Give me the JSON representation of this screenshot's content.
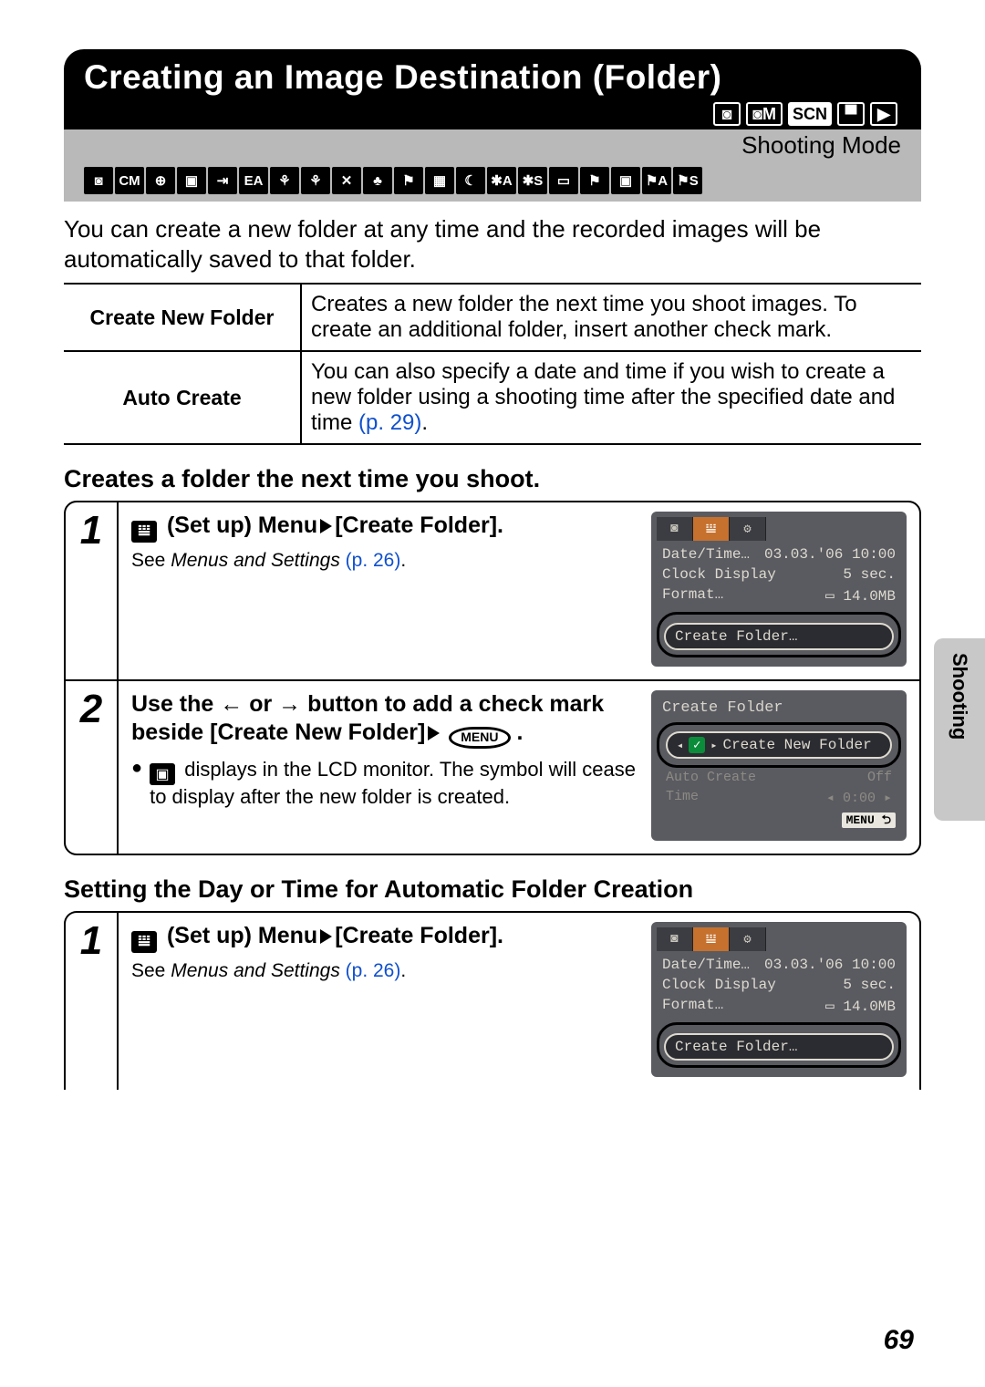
{
  "header": {
    "title": "Creating an Image Destination (Folder)",
    "mode_badges": [
      "◙",
      "◙M",
      "SCN",
      "▀",
      "▶"
    ],
    "shooting_mode_label": "Shooting Mode",
    "strip_icons": [
      "◙",
      "CM",
      "⊕",
      "▣",
      "⇥",
      "EA",
      "⚘",
      "⚘",
      "✕",
      "♣",
      "⚑",
      "▦",
      "☾",
      "✱A",
      "✱S",
      "▭",
      "⚑",
      "▣",
      "⚑A",
      "⚑S"
    ]
  },
  "intro": "You can create a new folder at any time and the recorded images will be automatically saved to that folder.",
  "table": {
    "row1_label": "Create New Folder",
    "row1_desc": "Creates a new folder the next time you shoot images. To create an additional folder, insert another check mark.",
    "row2_label": "Auto Create",
    "row2_desc_pre": "You can also specify a date and time if you wish to create a new folder using a shooting time after the specified date and time ",
    "row2_pref": "(p. 29)",
    "row2_desc_post": "."
  },
  "section1": {
    "heading": "Creates a folder the next time you shoot.",
    "step1": {
      "num": "1",
      "title_pre": " (Set up) Menu",
      "title_mid": "[Create Folder].",
      "note_pre": "See ",
      "note_ital": "Menus and Settings",
      "note_pref": " (p. 26)",
      "note_post": "."
    },
    "step2": {
      "num": "2",
      "title_a": "Use the ",
      "title_b": " or ",
      "title_c": " button to add a check mark beside [Create New Folder]",
      "title_d": " .",
      "bullet": " displays in the LCD monitor. The symbol will cease to display after the new folder is created."
    }
  },
  "section2": {
    "heading": "Setting the Day or Time for Automatic Folder Creation",
    "step1": {
      "num": "1",
      "title_pre": " (Set up) Menu",
      "title_mid": "[Create Folder].",
      "note_pre": "See ",
      "note_ital": "Menus and Settings",
      "note_pref": " (p. 26)",
      "note_post": "."
    }
  },
  "screenshot_setup": {
    "tabs": [
      "◙",
      "𝍎",
      "⚙"
    ],
    "line1_l": "Date/Time…",
    "line1_r": "03.03.'06 10:00",
    "line2_l": "Clock Display",
    "line2_r": "5 sec.",
    "line3_l": "Format…",
    "line3_r": "▭ 14.0MB",
    "highlight": "Create Folder…"
  },
  "screenshot_cf": {
    "title": "Create Folder",
    "option": "Create New Folder",
    "line1_l": "Auto Create",
    "line1_r": "Off",
    "line2_l": "Time",
    "line2_r": "◂ 0:00 ▸",
    "menu": "MENU ⮌"
  },
  "side_tab": "Shooting",
  "page_number": "69",
  "menu_oval": "MENU",
  "arrows": {
    "left": "←",
    "right": "→"
  }
}
